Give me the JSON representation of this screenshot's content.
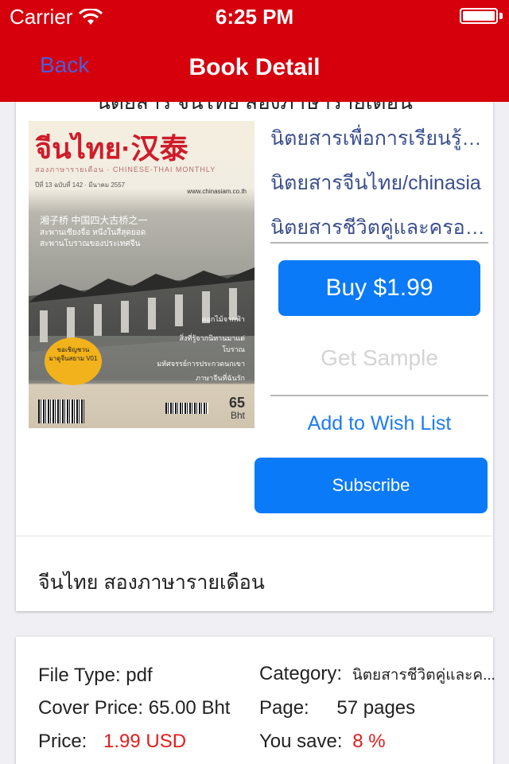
{
  "status_bar": {
    "carrier": "Carrier",
    "time": "6:25 PM"
  },
  "nav": {
    "back_label": "Back",
    "title": "Book Detail"
  },
  "book": {
    "clipped_title": "นิตยสาร จีนไทย สองภาษารายเดือน",
    "cover": {
      "title": "จีนไทย·汉泰",
      "subtitle": "สองภาษารายเดือน · CHINESE-THAI MONTHLY",
      "issue_line": "ปีที่ 13 ฉบับที่ 142 · มีนาคม 2557",
      "website": "www.chinasiam.co.th",
      "headline_cn": "湘子桥 中国四大古桥之一",
      "headline_th": "สะพานเซียงจื่อ หนึ่งในสี่สุดยอด\nสะพานโบราณของประเทศจีน",
      "badge": "ขอเชิญชวน\nมาดูจีนสยาม V01",
      "side1": "ดอกไม้จากฟ้า",
      "side2": "สิ่งที่รู้จากนิทานมาแต่\nโบราณ",
      "side3": "มหัศจรรย์การประกวดนกเขา",
      "side4": "ภาษาจีนที่ฉันรัก",
      "price_value": "65",
      "price_unit": "Bht"
    },
    "categories": [
      "นิตยสารเพื่อการเรียนรู้และการศึกษา",
      "นิตยสารจีนไทย/chinasia",
      "นิตยสารชีวิตคู่และครอบครัว"
    ],
    "buy_label": "Buy $1.99",
    "sample_label": "Get Sample",
    "wishlist_label": "Add to Wish List",
    "subscribe_label": "Subscribe",
    "description": "จีนไทย สองภาษารายเดือน"
  },
  "details": {
    "file_type_label": "File Type:",
    "file_type_value": "pdf",
    "cover_price_label": "Cover Price:",
    "cover_price_value": "65.00 Bht",
    "price_label": "Price:",
    "price_value": "1.99 USD",
    "category_label": "Category:",
    "category_value": "นิตยสารชีวิตคู่และค...",
    "page_label": "Page:",
    "page_value": "57 pages",
    "you_save_label": "You save:",
    "you_save_value": "8 %"
  },
  "colors": {
    "header": "#d6000d",
    "primary_button": "#0a7af8",
    "link": "#1d7bf5",
    "category_link": "#3b4f8f",
    "highlight": "#e41c1c"
  }
}
